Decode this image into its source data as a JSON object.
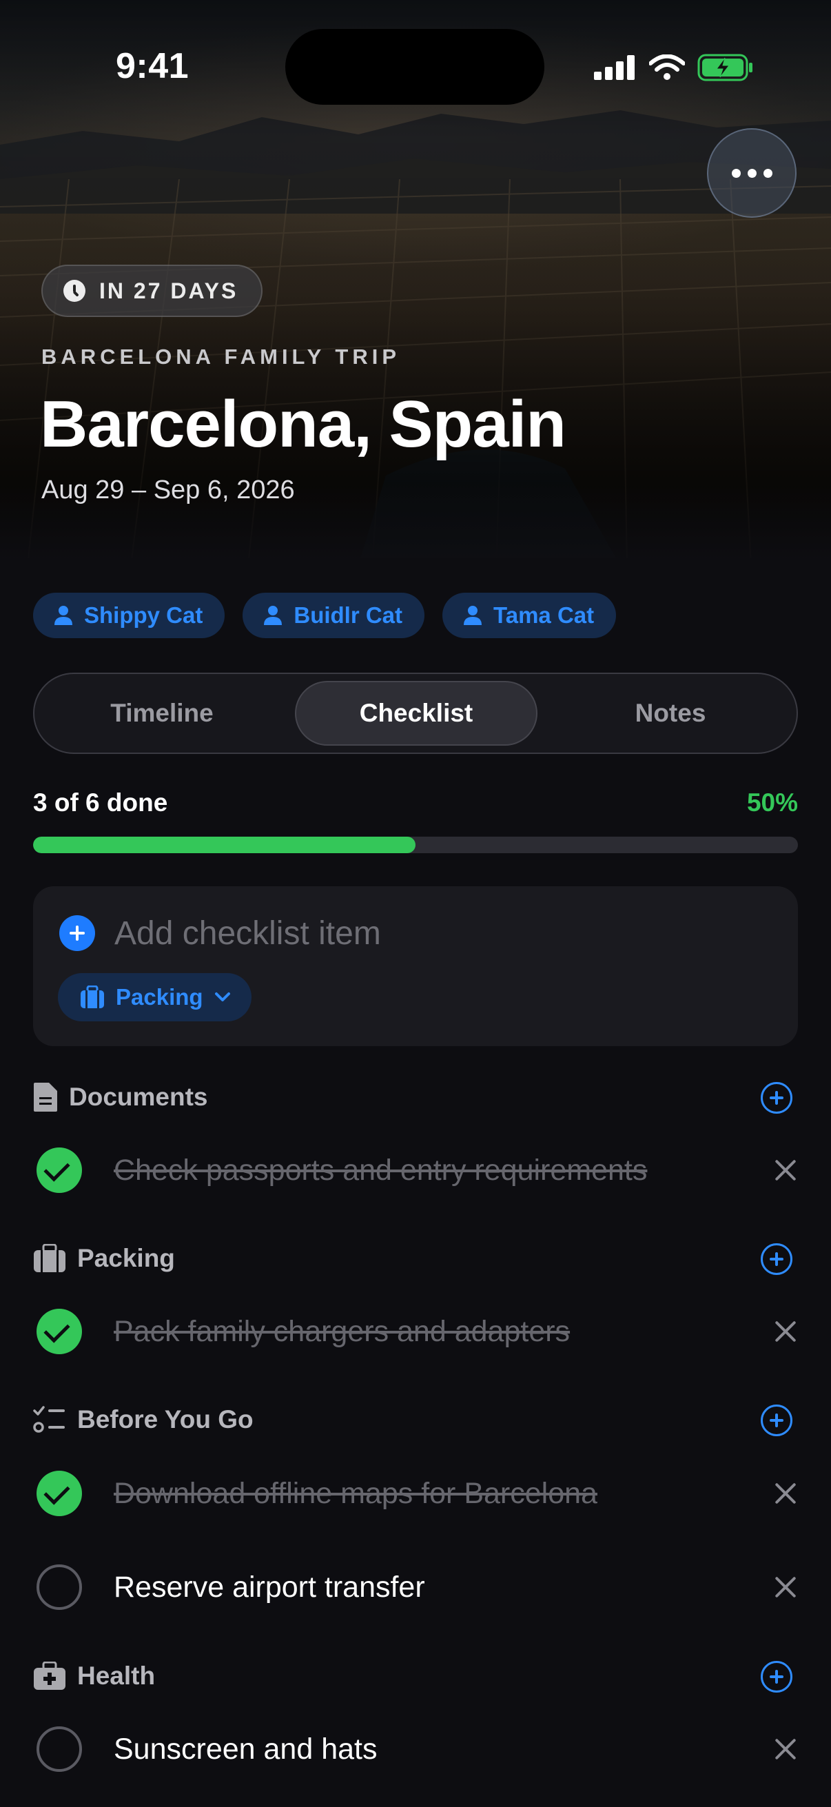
{
  "status_bar": {
    "time": "9:41",
    "icons": [
      "cellular-signal-icon",
      "wifi-icon",
      "battery-charging-icon"
    ]
  },
  "header": {
    "more_icon": "ellipsis-icon",
    "countdown": "IN 27 DAYS",
    "trip_label": "BARCELONA FAMILY TRIP",
    "title": "Barcelona, Spain",
    "dates": "Aug 29 – Sep 6, 2026"
  },
  "travelers": [
    {
      "name": "Shippy Cat"
    },
    {
      "name": "Buidlr Cat"
    },
    {
      "name": "Tama Cat"
    }
  ],
  "tabs": {
    "items": [
      "Timeline",
      "Checklist",
      "Notes"
    ],
    "selected": "Checklist"
  },
  "progress": {
    "label": "3 of 6 done",
    "percent_label": "50%",
    "fraction": 0.5
  },
  "add_item": {
    "placeholder": "Add checklist item",
    "category": "Packing"
  },
  "sections": [
    {
      "title": "Documents",
      "icon": "document-icon",
      "items": [
        {
          "text": "Check passports and entry requirements",
          "done": true
        }
      ]
    },
    {
      "title": "Packing",
      "icon": "suitcase-icon",
      "items": [
        {
          "text": "Pack family chargers and adapters",
          "done": true
        }
      ]
    },
    {
      "title": "Before You Go",
      "icon": "checklist-icon",
      "items": [
        {
          "text": "Download offline maps for Barcelona",
          "done": true
        },
        {
          "text": "Reserve airport transfer",
          "done": false
        }
      ]
    },
    {
      "title": "Health",
      "icon": "medical-kit-icon",
      "items": [
        {
          "text": "Sunscreen and hats",
          "done": false
        }
      ]
    }
  ],
  "colors": {
    "accent": "#2f8cff",
    "success": "#34c759",
    "background": "#0d0d11",
    "card": "#1a1a1f"
  }
}
